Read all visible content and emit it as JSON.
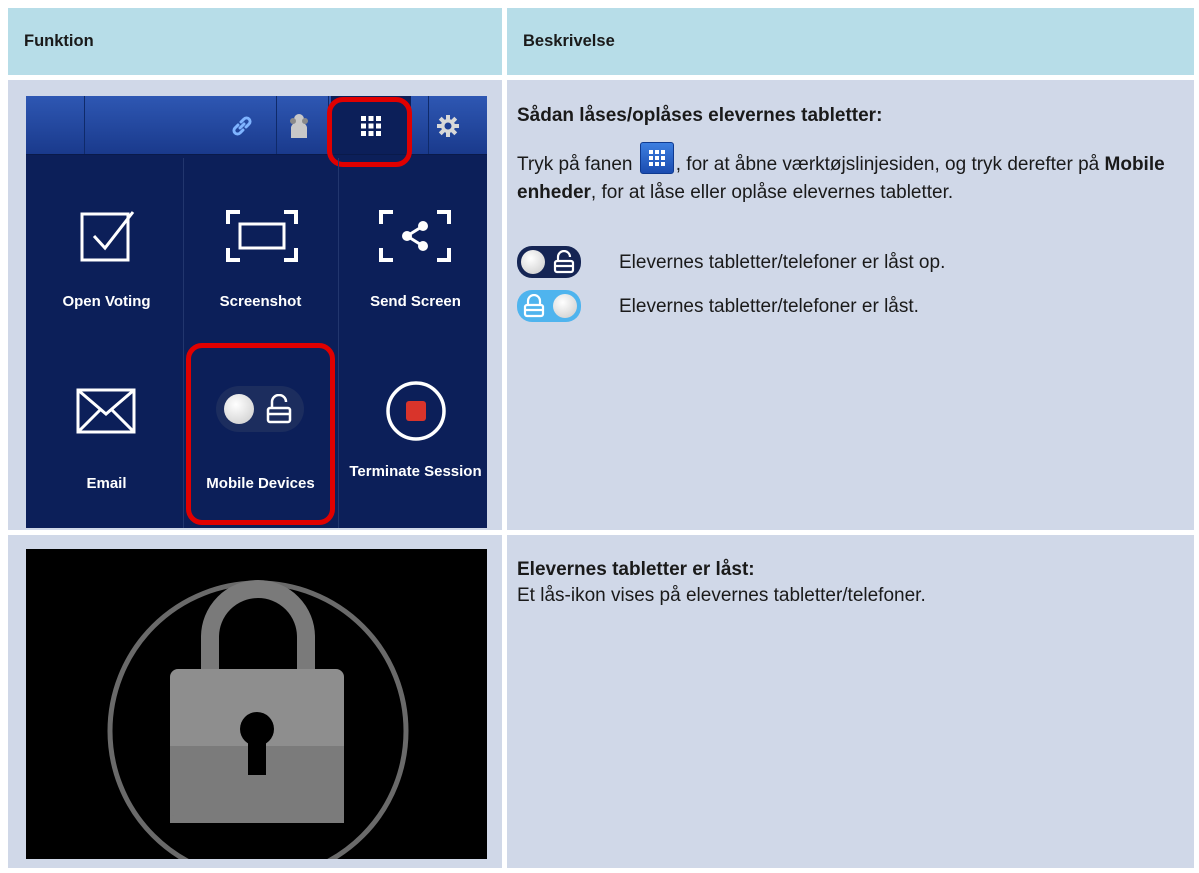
{
  "header": {
    "col1": "Funktion",
    "col2": "Beskrivelse"
  },
  "app": {
    "tiles": [
      {
        "label": "Open Voting",
        "icon": "checkbox-icon"
      },
      {
        "label": "Screenshot",
        "icon": "screenshot-icon"
      },
      {
        "label": "Send Screen",
        "icon": "share-icon"
      },
      {
        "label": "Email",
        "icon": "envelope-icon"
      },
      {
        "label": "Mobile Devices",
        "icon": "toggle-unlocked-icon"
      },
      {
        "label": "Terminate Session",
        "icon": "stop-icon"
      }
    ],
    "toolbar_icons": [
      "link-icon",
      "students-icon",
      "grid-icon",
      "gear-icon"
    ],
    "highlight_color": "#e00000",
    "panel_color": "#0c1f59"
  },
  "row1": {
    "heading": "Sådan låses/oplåses elevernes tabletter:",
    "text_pre": "Tryk på fanen ",
    "text_mid": ", for at åbne værktøjslinjesiden, og tryk derefter på ",
    "text_bold": "Mobile enheder",
    "text_post": ", for at låse eller oplåse elevernes tabletter.",
    "unlocked_desc": "Elevernes tabletter/telefoner er låst op.",
    "locked_desc": "Elevernes tabletter/telefoner er låst."
  },
  "row2": {
    "heading": "Elevernes tabletter er låst:",
    "text": "Et lås-ikon vises på elevernes tabletter/telefoner."
  },
  "colors": {
    "header_bg": "#b7dde8",
    "row_bg": "#d0d8e8"
  }
}
